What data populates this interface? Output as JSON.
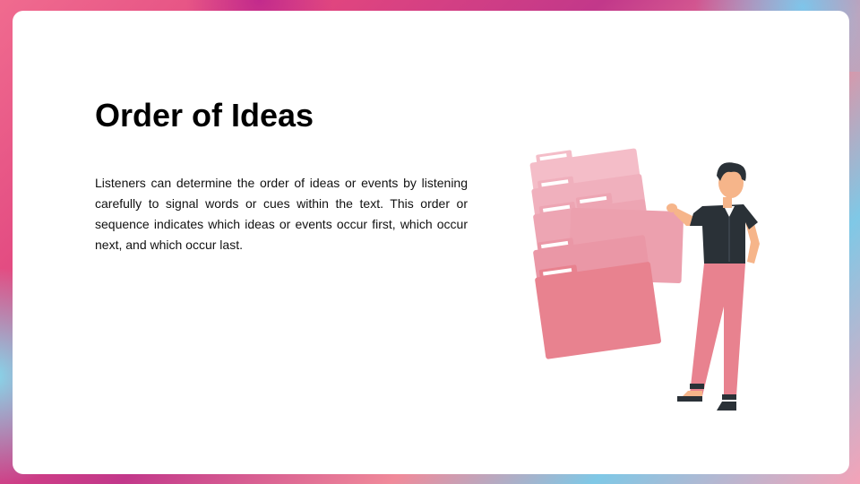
{
  "slide": {
    "title": "Order of Ideas",
    "body": "Listeners can determine the order of ideas or events by listening carefully to signal words or cues within the text. This order or sequence indicates which ideas or events occur first, which occur next, and which occur last."
  },
  "illustration": {
    "icon": "person-holding-folders-illustration"
  },
  "colors": {
    "folder_light": "#f4bdc8",
    "folder_mid": "#eea3b2",
    "folder_dark": "#e8828f",
    "shirt": "#2a3137",
    "pants": "#e8828f",
    "skin": "#f6b58a"
  }
}
